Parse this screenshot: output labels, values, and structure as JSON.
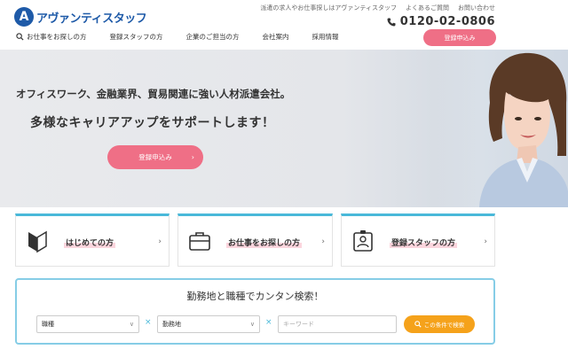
{
  "header": {
    "logo_mark": "A",
    "logo_text": "アヴァンティスタッフ",
    "top_links": [
      "派遣の求人やお仕事探しはアヴァンティスタッフ",
      "よくあるご質問",
      "お問い合わせ"
    ],
    "phone": "0120-02-0806",
    "register_label": "登録申込み"
  },
  "nav": {
    "items": [
      "お仕事をお探しの方",
      "登録スタッフの方",
      "企業のご担当の方",
      "会社案内",
      "採用情報"
    ]
  },
  "hero": {
    "sub": "オフィスワーク、金融業界、貿易関連に強い人材派遣会社。",
    "main": "多様なキャリアアップをサポートします！",
    "button": "登録申込み",
    "button_arrow": "›"
  },
  "cards": [
    {
      "label": "はじめての方",
      "icon": "beginner-mark-icon"
    },
    {
      "label": "お仕事をお探しの方",
      "icon": "briefcase-icon"
    },
    {
      "label": "登録スタッフの方",
      "icon": "id-card-icon"
    }
  ],
  "search": {
    "title": "勤務地と職種でカンタン検索！",
    "job_type": "職種",
    "location": "勤務地",
    "keyword_placeholder": "キーワード",
    "button": "この条件で検索"
  },
  "colors": {
    "brand": "#1e5aa8",
    "accent_pink": "#ef6f86",
    "accent_blue": "#49b9d9",
    "search_orange": "#f5a21b"
  }
}
